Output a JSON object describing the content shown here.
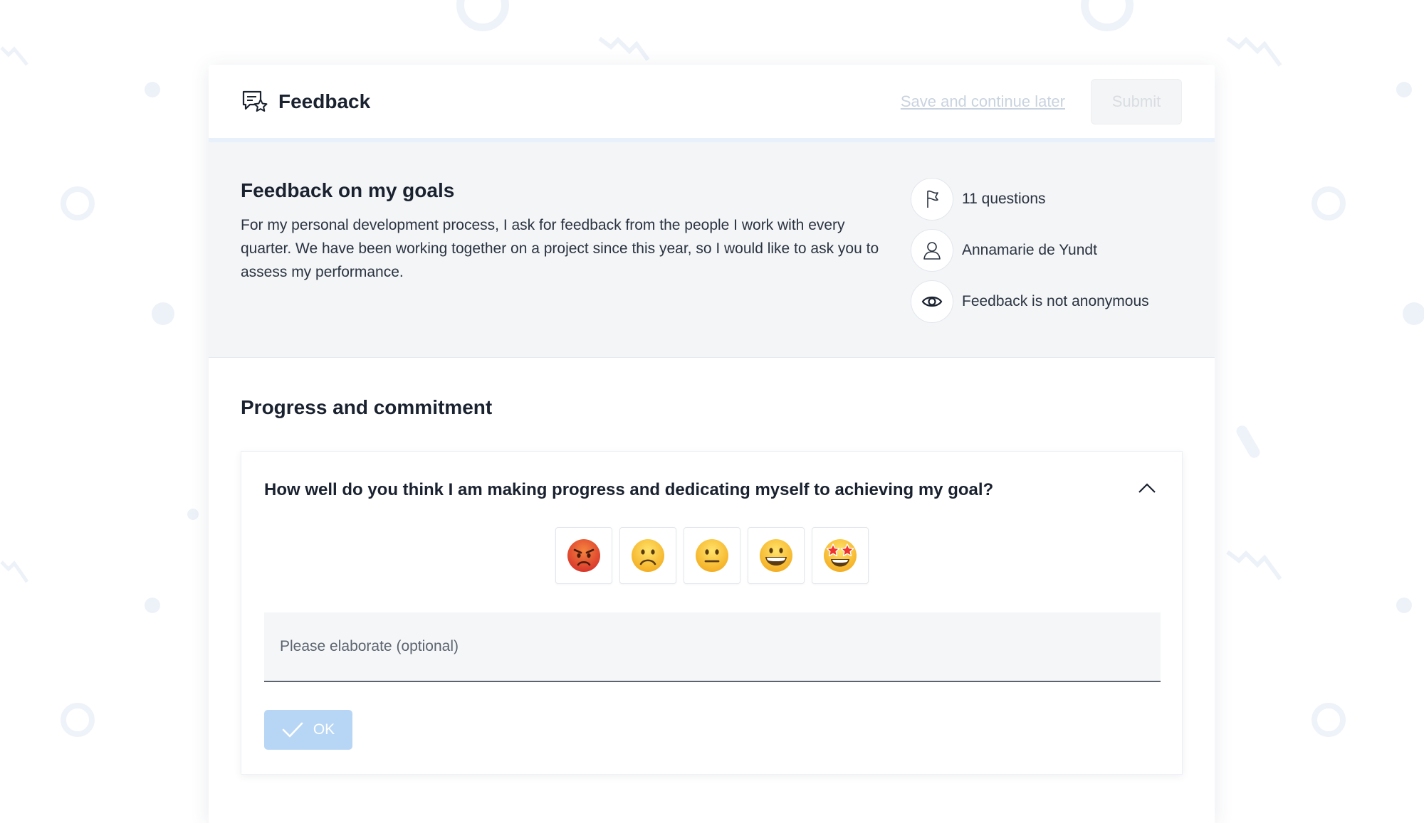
{
  "header": {
    "title": "Feedback",
    "save_label": "Save and continue later",
    "submit_label": "Submit"
  },
  "info": {
    "title": "Feedback on my goals",
    "description": "For my personal development process, I ask for feedback from the people I work with every quarter. We have been working together on a project since this year, so I would like to ask you to assess my performance.",
    "meta": [
      {
        "icon": "flag-icon",
        "text": "11 questions"
      },
      {
        "icon": "user-icon",
        "text": "Annamarie de Yundt"
      },
      {
        "icon": "eye-icon",
        "text": "Feedback is not anonymous"
      }
    ]
  },
  "section": {
    "title": "Progress and commitment"
  },
  "question": {
    "text": "How well do you think I am making progress and dedicating myself to achieving my goal?",
    "emoji_options": [
      "angry-face",
      "frowning-face",
      "neutral-face",
      "grinning-face",
      "star-struck-face"
    ],
    "elaborate_placeholder": "Please elaborate (optional)",
    "ok_label": "OK"
  },
  "colors": {
    "accent_light": "#b7d6f5",
    "header_border": "#e8f1fb",
    "info_bg": "#f3f5f7"
  }
}
